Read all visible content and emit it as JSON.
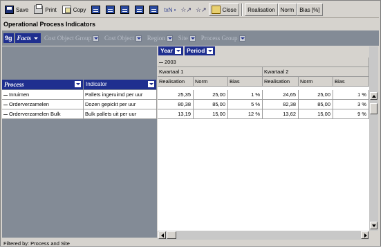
{
  "toolbar": {
    "save": "Save",
    "print": "Print",
    "copy": "Copy",
    "formula": "txN •",
    "close": "Close",
    "realisation": "Realisation",
    "norm": "Norm",
    "bias": "Bias [%]"
  },
  "title": "Operational Process Indicators",
  "filters": [
    {
      "label": "Facts",
      "active": true
    },
    {
      "label": "Cost Object Group",
      "active": false
    },
    {
      "label": "Cost Object",
      "active": false
    },
    {
      "label": "Region",
      "active": false
    },
    {
      "label": "Site",
      "active": false
    },
    {
      "label": "Process Group",
      "active": false
    }
  ],
  "filters_badge": "9g",
  "column_dims": {
    "year": "Year",
    "period": "Period"
  },
  "year_value": "2003",
  "quarters": [
    "Kwartaal 1",
    "Kwartaal 2"
  ],
  "measures": [
    "Realisation",
    "Norm",
    "Bias"
  ],
  "row_headers": {
    "process": "Process",
    "indicator": "Indicator"
  },
  "rows": [
    {
      "process": "Inruimen",
      "indicator": "Pallets ingeruimd per uur",
      "q1": [
        "25,35",
        "25,00",
        "1 %"
      ],
      "q2": [
        "24,65",
        "25,00",
        "1 %"
      ]
    },
    {
      "process": "Orderverzamelen",
      "indicator": "Dozen gepickt per uur",
      "q1": [
        "80,38",
        "85,00",
        "5 %"
      ],
      "q2": [
        "82,38",
        "85,00",
        "3 %"
      ]
    },
    {
      "process": "Orderverzamelen Bulk",
      "indicator": "Bulk pallets uit per uur",
      "q1": [
        "13,19",
        "15,00",
        "12 %"
      ],
      "q2": [
        "13,62",
        "15,00",
        "9 %"
      ]
    }
  ],
  "status": "Filtered by: Process and Site"
}
